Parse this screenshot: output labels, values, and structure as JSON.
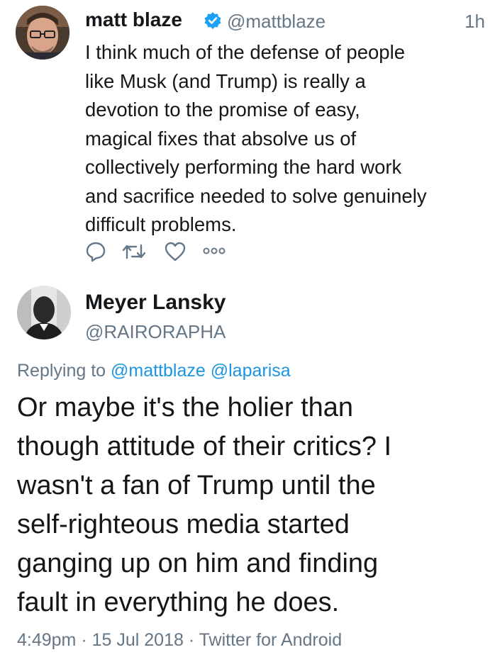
{
  "tweet1": {
    "display_name": "matt blaze",
    "handle": "@mattblaze",
    "time": "1h",
    "body": "I think much of the defense of people\nlike Musk (and Trump) is really a\ndevotion to the promise of easy,\nmagical fixes that absolve us of\ncollectively performing the hard work\nand sacrifice needed to solve genuinely\ndifficult problems.",
    "verified": true
  },
  "tweet2": {
    "display_name": "Meyer Lansky",
    "handle": "@RAIRORAPHA",
    "replying_to_label": "Replying to",
    "replying_to": [
      "@mattblaze",
      "@laparisa"
    ],
    "body": "Or maybe it's the holier than\nthough attitude of their critics? I\nwasn't a fan of Trump until the\nself-righteous media started\nganging up on him and finding\nfault in everything he does.",
    "timestamp": "4:49pm · 15 Jul 2018 · Twitter for Android"
  },
  "actions": [
    "reply-icon",
    "retweet-icon",
    "like-icon",
    "more-icon"
  ],
  "colors": {
    "text": "#14171a",
    "secondary": "#657786",
    "link": "#1b95e0",
    "verified": "#1da1f2"
  }
}
